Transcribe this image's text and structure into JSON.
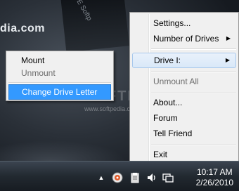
{
  "desktop": {
    "site_text": "dia.com",
    "stripe_text": "WE Softp",
    "watermark": "SOFTPEDIA",
    "watermark_url": "www.softpedia.com"
  },
  "main_menu": {
    "items": [
      {
        "label": "Settings...",
        "enabled": true,
        "submenu": false
      },
      {
        "label": "Number of Drives",
        "enabled": true,
        "submenu": true
      },
      {
        "label": "Drive I:",
        "enabled": true,
        "submenu": true,
        "highlighted": true
      },
      {
        "label": "Unmount All",
        "enabled": false,
        "submenu": false
      },
      {
        "label": "About...",
        "enabled": true,
        "submenu": false
      },
      {
        "label": "Forum",
        "enabled": true,
        "submenu": false
      },
      {
        "label": "Tell Friend",
        "enabled": true,
        "submenu": false
      },
      {
        "label": "Exit",
        "enabled": true,
        "submenu": false
      }
    ],
    "submenu_arrow": "▶"
  },
  "drive_submenu": {
    "items": [
      {
        "label": "Mount",
        "enabled": true
      },
      {
        "label": "Unmount",
        "enabled": false
      },
      {
        "label": "Change Drive Letter",
        "enabled": true,
        "selected": true
      }
    ]
  },
  "taskbar": {
    "tray_icons": [
      "show-hidden-icons-arrow",
      "app-tray-icon",
      "clipboard-icon",
      "volume-icon",
      "network-icon"
    ],
    "show_hidden_glyph": "▲",
    "volume_glyph": "🔈",
    "clock": {
      "time": "10:17 AM",
      "date": "2/26/2010"
    }
  },
  "colors": {
    "menu_bg": "#f0f0f0",
    "selection": "#3399ff",
    "taskbar": "#222930"
  }
}
